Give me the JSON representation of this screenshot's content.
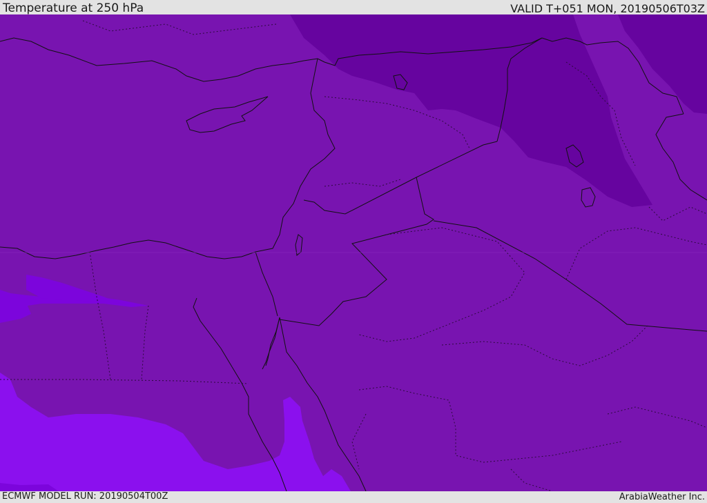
{
  "header": {
    "title": "Temperature at 250 hPa",
    "valid_time": "VALID T+051 MON, 20190506T03Z"
  },
  "footer": {
    "model_run": "ECMWF MODEL RUN: 20190504T00Z",
    "credit": "ArabiaWeather Inc."
  },
  "map": {
    "field": "temperature-250hPa",
    "colors": {
      "base": "#7814b0",
      "cold": "#66049f",
      "warm_light": "#7c05dc",
      "warm": "#8b10ee",
      "border": "#111111",
      "admin_border": "#2a0a3a"
    }
  }
}
